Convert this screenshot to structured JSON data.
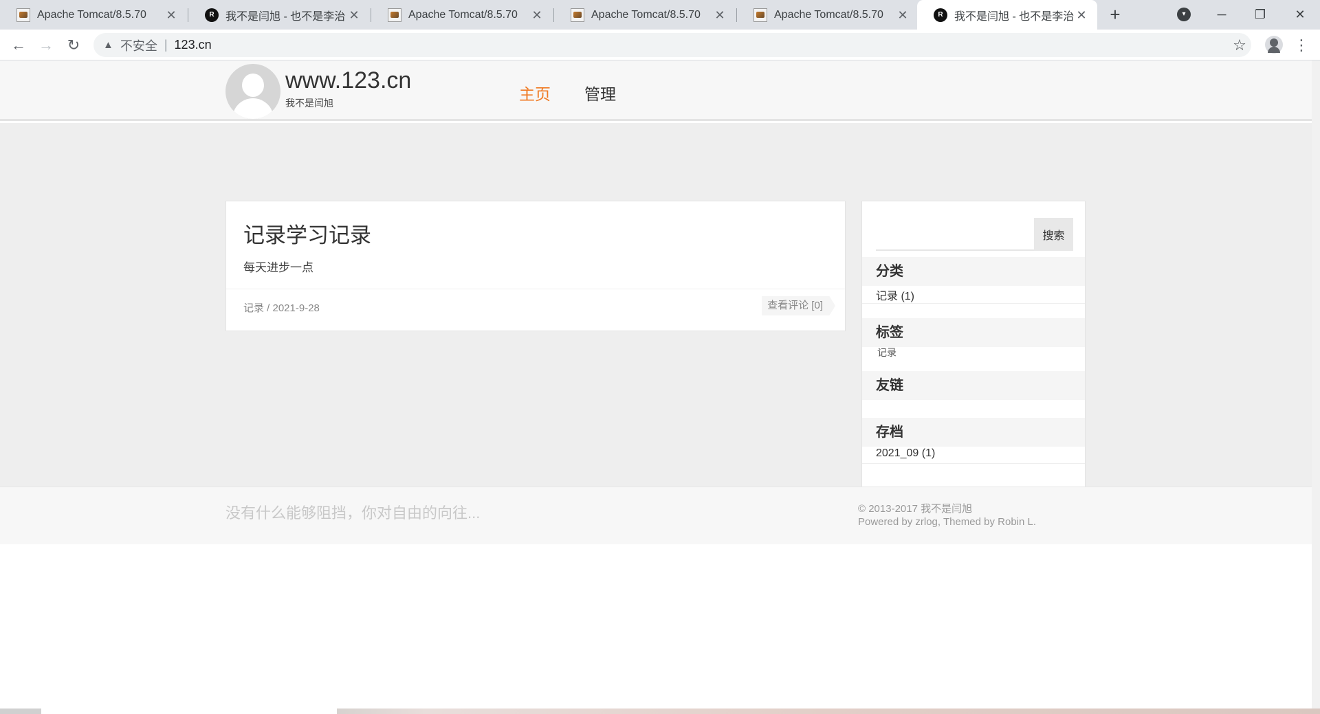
{
  "browser": {
    "tabs": [
      {
        "title": "Apache Tomcat/8.5.70",
        "icon": "tomcat-favicon"
      },
      {
        "title": "我不是闫旭 - 也不是李治",
        "icon": "site-favicon"
      },
      {
        "title": "Apache Tomcat/8.5.70",
        "icon": "tomcat-favicon"
      },
      {
        "title": "Apache Tomcat/8.5.70",
        "icon": "tomcat-favicon"
      },
      {
        "title": "Apache Tomcat/8.5.70",
        "icon": "tomcat-favicon"
      },
      {
        "title": "我不是闫旭 - 也不是李治",
        "icon": "site-favicon",
        "active": true
      }
    ],
    "address": {
      "security_label": "不安全",
      "url": "123.cn"
    }
  },
  "site": {
    "title": "www.123.cn",
    "subtitle": "我不是闫旭",
    "nav": {
      "home": "主页",
      "admin": "管理"
    },
    "accent_color": "#f07a23"
  },
  "post": {
    "title": "记录学习记录",
    "excerpt": "每天进步一点",
    "meta": "记录 / 2021-9-28",
    "comments": "查看评论 [0]"
  },
  "sidebar": {
    "search_button": "搜索",
    "categories": {
      "title": "分类",
      "items": [
        "记录 (1)"
      ]
    },
    "tags": {
      "title": "标签",
      "items": [
        "记录"
      ]
    },
    "links": {
      "title": "友链"
    },
    "archive": {
      "title": "存档",
      "items": [
        "2021_09 (1)"
      ]
    }
  },
  "footer": {
    "motto": "没有什么能够阻挡，你对自由的向往...",
    "copyright": "© 2013-2017 我不是闫旭",
    "powered": "Powered by zrlog, Themed by Robin L."
  }
}
